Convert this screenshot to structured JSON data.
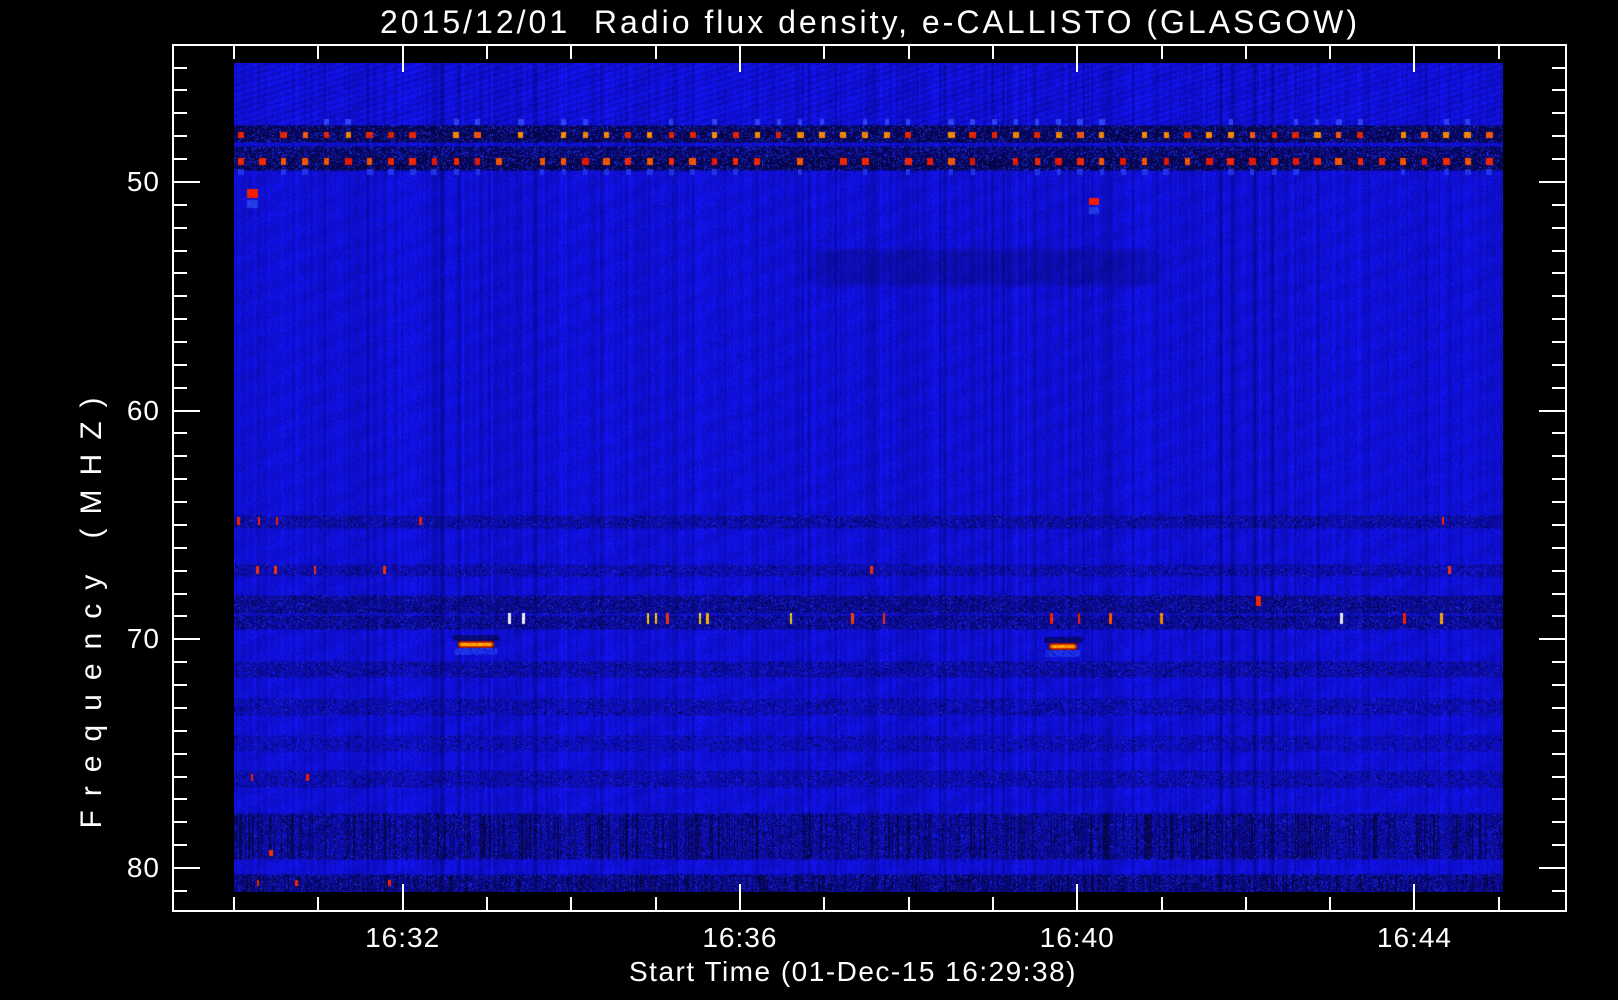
{
  "chart_data": {
    "type": "heatmap",
    "title": "2015/12/01  Radio flux density, e-CALLISTO (GLASGOW)",
    "xlabel": "Start Time (01-Dec-15 16:29:38)",
    "ylabel": "Frequency (MHZ)",
    "instrument": "e-CALLISTO",
    "station": "GLASGOW",
    "date": "2015/12/01",
    "start_time": "16:29:38",
    "x_axis": {
      "range_min": [
        30.0,
        45.05
      ],
      "minor_step_min": 1,
      "major": [
        {
          "t": 32,
          "label": "16:32"
        },
        {
          "t": 36,
          "label": "16:36"
        },
        {
          "t": 40,
          "label": "16:40"
        },
        {
          "t": 44,
          "label": "16:44"
        }
      ]
    },
    "y_axis": {
      "range_mhz": [
        44.8,
        81.05
      ],
      "minor_step_mhz": 1,
      "major": [
        50,
        60,
        70,
        80
      ],
      "inverted": true
    },
    "palette": {
      "page_bg": "#000000",
      "frame": "#ffffff",
      "text": "#ffffff",
      "base_blue": "#1010d2",
      "dark_blue": "#050560",
      "bright_blue": "#2a3cff"
    },
    "features": {
      "rfi_dot_bands": [
        {
          "name": "48 MHz interference band",
          "strip_lo": 47.5,
          "strip_hi": 48.25,
          "strip_darken": 0.55,
          "strip_speckle": 0.45,
          "dot_f": 47.95,
          "dot_h_mhz": 0.3,
          "period_min": 0.2553,
          "phase_min": 0.08,
          "colors": [
            "#ff8800",
            "#ff5510",
            "#e02500"
          ],
          "skip": 0.12,
          "blue_dot_f": 47.38,
          "blue_dot_color": "#2e41ff"
        },
        {
          "name": "49 MHz interference band",
          "strip_lo": 48.92,
          "strip_hi": 49.48,
          "strip_darken": 0.6,
          "strip_speckle": 0.5,
          "dot_f": 49.1,
          "dot_h_mhz": 0.33,
          "period_min": 0.2553,
          "phase_min": 0.08,
          "colors": [
            "#ff2800",
            "#e81800",
            "#ff5500"
          ],
          "skip": 0.08,
          "blue_dot_f": 49.55,
          "blue_dot_color": "#2233e8"
        }
      ],
      "static_band": {
        "f_lo": 48.42,
        "f_hi": 48.92,
        "darken": 0.42,
        "speckle": 0.5
      },
      "smudge": {
        "t0": 36.66,
        "t1": 41.1,
        "f_lo": 52.85,
        "f_hi": 54.6,
        "darken": 0.2
      },
      "noise_rows": [
        {
          "f_lo": 64.55,
          "f_hi": 65.15,
          "darken": 0.18,
          "speckle": 0.15
        },
        {
          "f_lo": 66.7,
          "f_hi": 67.25,
          "darken": 0.15,
          "speckle": 0.13
        },
        {
          "f_lo": 68.05,
          "f_hi": 68.85,
          "darken": 0.27,
          "speckle": 0.25
        },
        {
          "f_lo": 68.95,
          "f_hi": 69.55,
          "darken": 0.24,
          "speckle": 0.25
        },
        {
          "f_lo": 70.95,
          "f_hi": 71.65,
          "darken": 0.17,
          "speckle": 0.16
        },
        {
          "f_lo": 72.55,
          "f_hi": 73.3,
          "darken": 0.13,
          "speckle": 0.14
        },
        {
          "f_lo": 74.2,
          "f_hi": 74.9,
          "darken": 0.11,
          "speckle": 0.1
        },
        {
          "f_lo": 75.7,
          "f_hi": 76.45,
          "darken": 0.14,
          "speckle": 0.13
        },
        {
          "f_lo": 77.6,
          "f_hi": 79.6,
          "darken": 0.2,
          "speckle": 0.2,
          "dark_columns": 0.22
        },
        {
          "f_lo": 80.25,
          "f_hi": 81.05,
          "darken": 0.28,
          "speckle": 0.3,
          "dark_columns": 0.18
        }
      ],
      "streaks": [
        {
          "t0": 32.66,
          "t1": 33.07,
          "f": 70.22
        },
        {
          "t0": 39.66,
          "t1": 39.99,
          "f": 70.28
        }
      ],
      "spots": [
        {
          "t": 30.22,
          "f": 50.5,
          "w_min": 0.13,
          "h_mhz": 0.38,
          "color": "#ff1e00",
          "blue_below": true
        },
        {
          "t": 40.2,
          "f": 50.85,
          "w_min": 0.11,
          "h_mhz": 0.33,
          "color": "#ff1e00",
          "blue_below": true
        },
        {
          "t": 42.15,
          "f": 68.32,
          "w_min": 0.07,
          "h_mhz": 0.45,
          "color": "#ff2a00",
          "blue_below": false
        },
        {
          "t": 30.44,
          "f": 79.35,
          "w_min": 0.05,
          "h_mhz": 0.25,
          "color": "#ff3000",
          "blue_below": false
        }
      ],
      "tick_rows": [
        {
          "f": 69.1,
          "h_mhz": 0.5,
          "items": [
            {
              "t": 33.27,
              "c": "#f5f5ff"
            },
            {
              "t": 33.43,
              "c": "#f5f5ff"
            },
            {
              "t": 34.91,
              "c": "#ffd000"
            },
            {
              "t": 35.0,
              "c": "#ffd000"
            },
            {
              "t": 35.14,
              "c": "#ff3300"
            },
            {
              "t": 35.53,
              "c": "#ffd000"
            },
            {
              "t": 35.62,
              "c": "#ffb000"
            },
            {
              "t": 36.6,
              "c": "#ffd000"
            },
            {
              "t": 37.33,
              "c": "#ff4000"
            },
            {
              "t": 37.71,
              "c": "#ff3000"
            },
            {
              "t": 39.69,
              "c": "#ff2200"
            },
            {
              "t": 40.02,
              "c": "#ff2200"
            },
            {
              "t": 40.39,
              "c": "#ff5500"
            },
            {
              "t": 41.0,
              "c": "#ff8800"
            },
            {
              "t": 43.13,
              "c": "#f0f0ff"
            },
            {
              "t": 43.88,
              "c": "#ff2200"
            },
            {
              "t": 44.32,
              "c": "#ffaa00"
            }
          ]
        },
        {
          "f": 64.82,
          "h_mhz": 0.35,
          "items": [
            {
              "t": 30.05,
              "c": "#ff2200"
            },
            {
              "t": 30.3,
              "c": "#ff2200"
            },
            {
              "t": 30.51,
              "c": "#ff2200"
            },
            {
              "t": 32.21,
              "c": "#ff2200"
            },
            {
              "t": 44.34,
              "c": "#ff2200"
            }
          ]
        },
        {
          "f": 66.95,
          "h_mhz": 0.35,
          "items": [
            {
              "t": 30.28,
              "c": "#ff3300"
            },
            {
              "t": 30.49,
              "c": "#ff3300"
            },
            {
              "t": 30.96,
              "c": "#ff3300"
            },
            {
              "t": 31.79,
              "c": "#ff3300"
            },
            {
              "t": 37.56,
              "c": "#ff3300"
            },
            {
              "t": 44.41,
              "c": "#ff3300"
            }
          ]
        },
        {
          "f": 76.05,
          "h_mhz": 0.3,
          "items": [
            {
              "t": 30.21,
              "c": "#ff2200"
            },
            {
              "t": 30.87,
              "c": "#ff2200"
            }
          ]
        },
        {
          "f": 80.65,
          "h_mhz": 0.25,
          "items": [
            {
              "t": 30.28,
              "c": "#ff2500"
            },
            {
              "t": 30.74,
              "c": "#ff2500"
            },
            {
              "t": 31.85,
              "c": "#ff2500"
            }
          ]
        }
      ]
    }
  }
}
